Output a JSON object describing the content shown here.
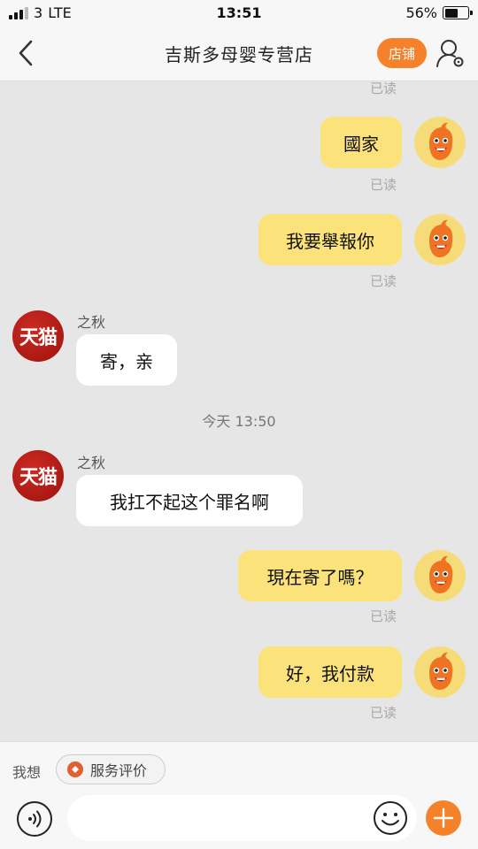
{
  "status_bar": {
    "carrier": "3",
    "network": "LTE",
    "time": "13:51",
    "battery": "56%",
    "battery_level": 0.56
  },
  "header": {
    "title": "吉斯多母婴专营店",
    "shop_button": "店铺",
    "back_icon": "chevron-left-icon",
    "user_icon": "user-settings-icon"
  },
  "messages": {
    "read_top": "已读",
    "m1": {
      "text": "國家",
      "status": "已读"
    },
    "m2": {
      "text": "我要舉報你",
      "status": "已读"
    },
    "m3": {
      "sender": "之秋",
      "avatar": "天猫",
      "text": "寄，亲"
    },
    "time_divider": "今天 13:50",
    "m4": {
      "sender": "之秋",
      "avatar": "天猫",
      "text": "我扛不起这个罪名啊"
    },
    "m5": {
      "text": "現在寄了嗎？",
      "status": "已读"
    },
    "m6": {
      "text": "好，我付款",
      "status": "已读"
    }
  },
  "bottom": {
    "wish_label": "我想",
    "service_chip": "服务评价",
    "input_placeholder": "",
    "voice_icon": "voice-icon",
    "emoji_icon": "emoji-icon",
    "plus_icon": "plus-icon"
  },
  "colors": {
    "accent": "#f5822a",
    "my_bubble": "#fbe27a",
    "their_bubble": "#ffffff",
    "background": "#e6e6e6"
  }
}
